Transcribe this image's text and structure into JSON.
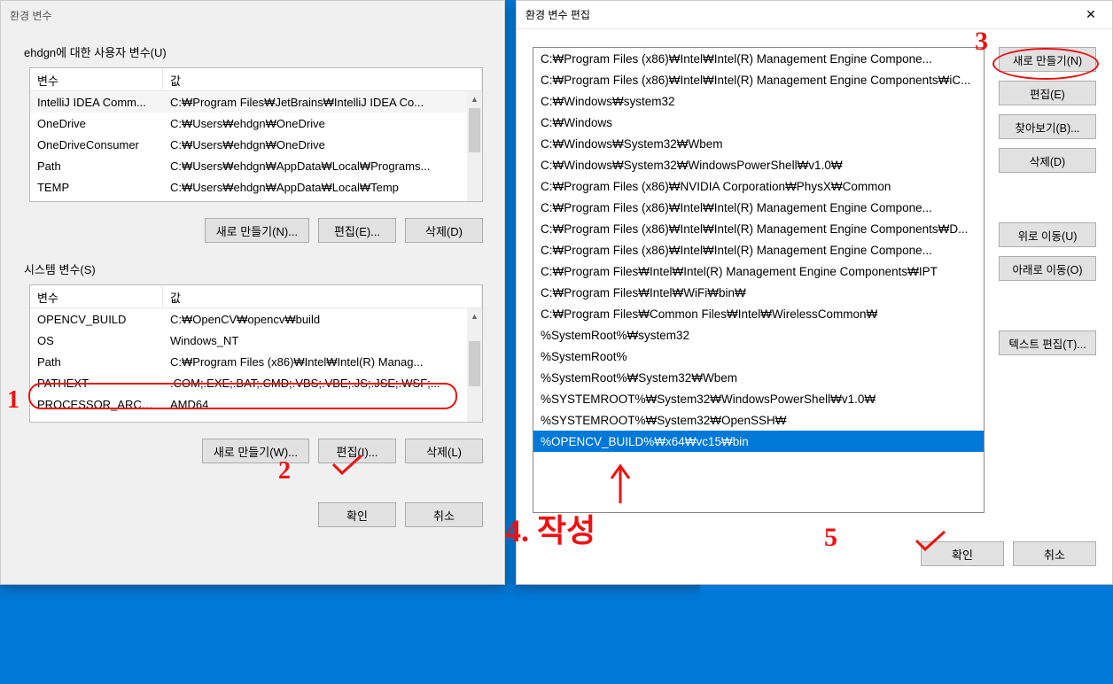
{
  "dialog1": {
    "title": "환경 변수",
    "user_section_label": "ehdgn에 대한 사용자 변수(U)",
    "col_var": "변수",
    "col_val": "값",
    "user_vars": [
      {
        "name": "IntelliJ IDEA Comm...",
        "value": "C:\\Program Files\\JetBrains\\IntelliJ IDEA Co..."
      },
      {
        "name": "OneDrive",
        "value": "C:\\Users\\ehdgn\\OneDrive"
      },
      {
        "name": "OneDriveConsumer",
        "value": "C:\\Users\\ehdgn\\OneDrive"
      },
      {
        "name": "Path",
        "value": "C:\\Users\\ehdgn\\AppData\\Local\\Programs..."
      },
      {
        "name": "TEMP",
        "value": "C:\\Users\\ehdgn\\AppData\\Local\\Temp"
      }
    ],
    "user_buttons": {
      "new": "새로 만들기(N)...",
      "edit": "편집(E)...",
      "delete": "삭제(D)"
    },
    "system_section_label": "시스템 변수(S)",
    "system_vars": [
      {
        "name": "OPENCV_BUILD",
        "value": "C:\\OpenCV\\opencv\\build"
      },
      {
        "name": "OS",
        "value": "Windows_NT"
      },
      {
        "name": "Path",
        "value": "C:\\Program Files (x86)\\Intel\\Intel(R) Manag..."
      },
      {
        "name": "PATHEXT",
        "value": ".COM;.EXE;.BAT;.CMD;.VBS;.VBE;.JS;.JSE;.WSF;..."
      },
      {
        "name": "PROCESSOR_ARCH...",
        "value": "AMD64"
      }
    ],
    "system_buttons": {
      "new": "새로 만들기(W)...",
      "edit": "편집(I)...",
      "delete": "삭제(L)"
    },
    "ok": "확인",
    "cancel": "취소"
  },
  "dialog2": {
    "title": "환경 변수 편집",
    "paths": [
      "C:\\Program Files (x86)\\Intel\\Intel(R) Management Engine Compone...",
      "C:\\Program Files (x86)\\Intel\\Intel(R) Management Engine Components\\iC...",
      "C:\\Windows\\system32",
      "C:\\Windows",
      "C:\\Windows\\System32\\Wbem",
      "C:\\Windows\\System32\\WindowsPowerShell\\v1.0\\",
      "C:\\Program Files (x86)\\NVIDIA Corporation\\PhysX\\Common",
      "C:\\Program Files (x86)\\Intel\\Intel(R) Management Engine Compone...",
      "C:\\Program Files (x86)\\Intel\\Intel(R) Management Engine Components\\D...",
      "C:\\Program Files (x86)\\Intel\\Intel(R) Management Engine Compone...",
      "C:\\Program Files\\Intel\\Intel(R) Management Engine Components\\IPT",
      "C:\\Program Files\\Intel\\WiFi\\bin\\",
      "C:\\Program Files\\Common Files\\Intel\\WirelessCommon\\",
      "%SystemRoot%\\system32",
      "%SystemRoot%",
      "%SystemRoot%\\System32\\Wbem",
      "%SYSTEMROOT%\\System32\\WindowsPowerShell\\v1.0\\",
      "%SYSTEMROOT%\\System32\\OpenSSH\\",
      "%OPENCV_BUILD%\\x64\\vc15\\bin"
    ],
    "selected_index": 18,
    "buttons": {
      "new": "새로 만들기(N)",
      "edit": "편집(E)",
      "browse": "찾아보기(B)...",
      "delete": "삭제(D)",
      "move_up": "위로 이동(U)",
      "move_down": "아래로 이동(O)",
      "text_edit": "텍스트 편집(T)..."
    },
    "ok": "확인",
    "cancel": "취소"
  },
  "annotations": {
    "n1": "1",
    "n2": "2",
    "n3": "3",
    "n4": "4. 작성",
    "n5": "5"
  }
}
